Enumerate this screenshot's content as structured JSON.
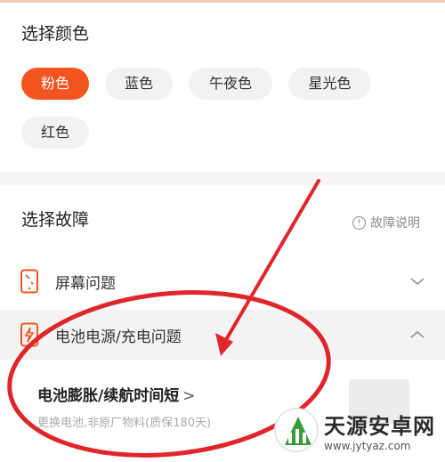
{
  "color_section": {
    "title": "选择颜色",
    "options": [
      "粉色",
      "蓝色",
      "午夜色",
      "星光色",
      "红色"
    ],
    "selected": "粉色"
  },
  "fault_section": {
    "title": "选择故障",
    "help_label": "故障说明",
    "categories": [
      {
        "label": "屏幕问题",
        "icon": "phone-screen-icon",
        "state": "collapsed"
      },
      {
        "label": "电池电源/充电问题",
        "icon": "battery-charge-icon",
        "state": "expanded"
      }
    ],
    "sub_item": {
      "title": "电池膨胀/续航时间短",
      "arrow": ">",
      "description": "更换电池,非原厂物料(质保180天)"
    }
  },
  "watermark": {
    "name": "天源安卓网",
    "url": "www.jytyaz.com"
  },
  "colors": {
    "accent": "#f4541f",
    "annotation": "#e0262a"
  }
}
